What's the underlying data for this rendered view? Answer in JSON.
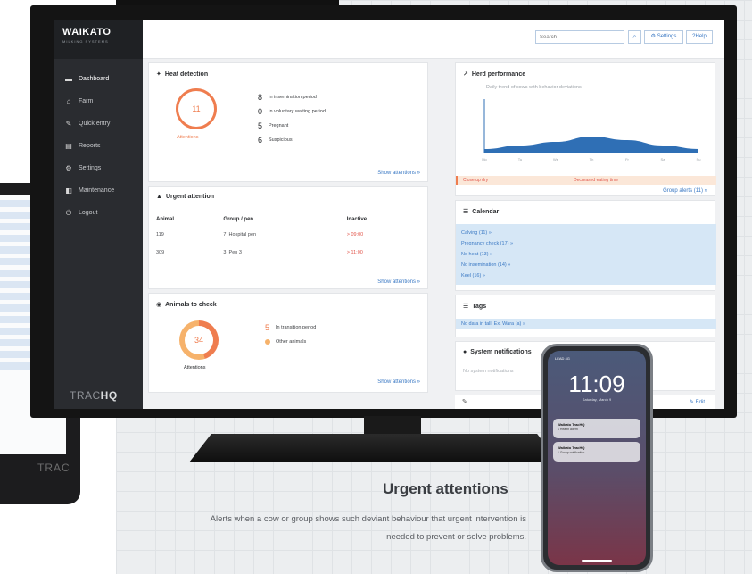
{
  "app": {
    "brand": "WAIKATO",
    "brand_sub": "MILKING SYSTEMS",
    "product": "TRACHQ",
    "product_light": "TRAC",
    "product_bold": "HQ"
  },
  "sidebar": {
    "items": [
      {
        "icon": "dashboard-icon",
        "label": "Dashboard"
      },
      {
        "icon": "home-icon",
        "label": "Farm"
      },
      {
        "icon": "edit-icon",
        "label": "Quick entry"
      },
      {
        "icon": "reports-icon",
        "label": "Reports"
      },
      {
        "icon": "settings-icon",
        "label": "Settings"
      },
      {
        "icon": "maintenance-icon",
        "label": "Maintenance"
      },
      {
        "icon": "logout-icon",
        "label": "Logout"
      }
    ]
  },
  "topbar": {
    "search_placeholder": "Search",
    "settings_label": "Settings",
    "help_label": "Help"
  },
  "heat": {
    "title": "Heat detection",
    "count": "11",
    "count_label": "Attentions",
    "stats": [
      {
        "n": "8",
        "label": "In insemination period"
      },
      {
        "n": "0",
        "label": "In voluntary waiting period"
      },
      {
        "n": "5",
        "label": "Pregnant"
      },
      {
        "n": "6",
        "label": "Suspicious"
      }
    ],
    "link": "Show attentions »"
  },
  "urgent": {
    "title": "Urgent attention",
    "columns": [
      "Animal",
      "Group / pen",
      "Inactive"
    ],
    "rows": [
      {
        "animal": "119",
        "group": "7. Hospital pen",
        "inactive": "> 09:00"
      },
      {
        "animal": "309",
        "group": "3. Pen 3",
        "inactive": "> 11:00"
      }
    ],
    "link": "Show attentions »"
  },
  "check": {
    "title": "Animals to check",
    "count": "34",
    "count_label": "Attentions",
    "stats": [
      {
        "n": "5",
        "label": "In transition period"
      },
      {
        "n": "",
        "label": "Other animals"
      }
    ],
    "link": "Show attentions »"
  },
  "herd": {
    "title": "Herd performance",
    "subtitle": "Daily trend of cows with behavior deviations",
    "alert_left": "Close up dry",
    "alert_right": "Decreased eating time",
    "link": "Group alerts (11) »"
  },
  "calendar": {
    "title": "Calendar",
    "items": [
      "Calving (11) »",
      "Pregnancy check (17) »",
      "No heat (13) »",
      "No insemination (14) »",
      "Keel (16) »"
    ]
  },
  "tags": {
    "title": "Tags",
    "row": "No data in tall. Ex. Wara (a) »"
  },
  "sysn": {
    "title": "System notifications",
    "empty": "No system notifications"
  },
  "footer": {
    "edit": "Edit"
  },
  "phone": {
    "status": "LEAD 4G",
    "time": "11:09",
    "date": "Saturday, March 9",
    "notifs": [
      {
        "title": "Waikato TracHQ",
        "sub": "1 Health alarm"
      },
      {
        "title": "Waikato TracHQ",
        "sub": "1 Group notification"
      }
    ]
  },
  "caption": {
    "title": "Urgent attentions",
    "text": "Alerts when a cow or group shows such deviant behaviour that urgent intervention is needed to prevent or solve problems."
  },
  "chart_data": {
    "type": "area",
    "title": "Herd performance",
    "subtitle": "Daily trend of cows with behavior deviations",
    "x": [
      "Mo",
      "Tu",
      "We",
      "Th",
      "Fr",
      "Sa",
      "Su"
    ],
    "series": [
      {
        "values": [
          2,
          4,
          6,
          9,
          7,
          4,
          2
        ]
      }
    ],
    "ylim": [
      0,
      30
    ],
    "colors": {
      "area": "#2f6fb5"
    }
  },
  "colors": {
    "accent": "#3b79c4",
    "orange": "#ef7d4f",
    "alert": "#e2574c",
    "sidebar": "#2a2c30"
  }
}
